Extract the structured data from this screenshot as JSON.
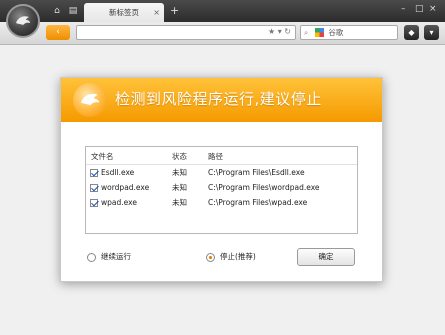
{
  "browser": {
    "tab_title": "新标签页",
    "tab_close": "×",
    "new_tab": "+",
    "search_placeholder": "谷歌"
  },
  "dialog": {
    "title": "检测到风险程序运行,建议停止",
    "columns": [
      "文件名",
      "状态",
      "路径"
    ],
    "rows": [
      {
        "name": "Esdll.exe",
        "status": "未知",
        "path": "C:\\Program Files\\Esdll.exe",
        "checked": true
      },
      {
        "name": "wordpad.exe",
        "status": "未知",
        "path": "C:\\Program Files\\wordpad.exe",
        "checked": true
      },
      {
        "name": "wpad.exe",
        "status": "未知",
        "path": "C:\\Program Files\\wpad.exe",
        "checked": true
      }
    ],
    "options": {
      "continue_label": "继续运行",
      "stop_label": "停止(推荐)",
      "selected": "stop"
    },
    "ok_label": "确定"
  },
  "colors": {
    "accent": "#f59a00",
    "header_light": "#ffc23a"
  }
}
